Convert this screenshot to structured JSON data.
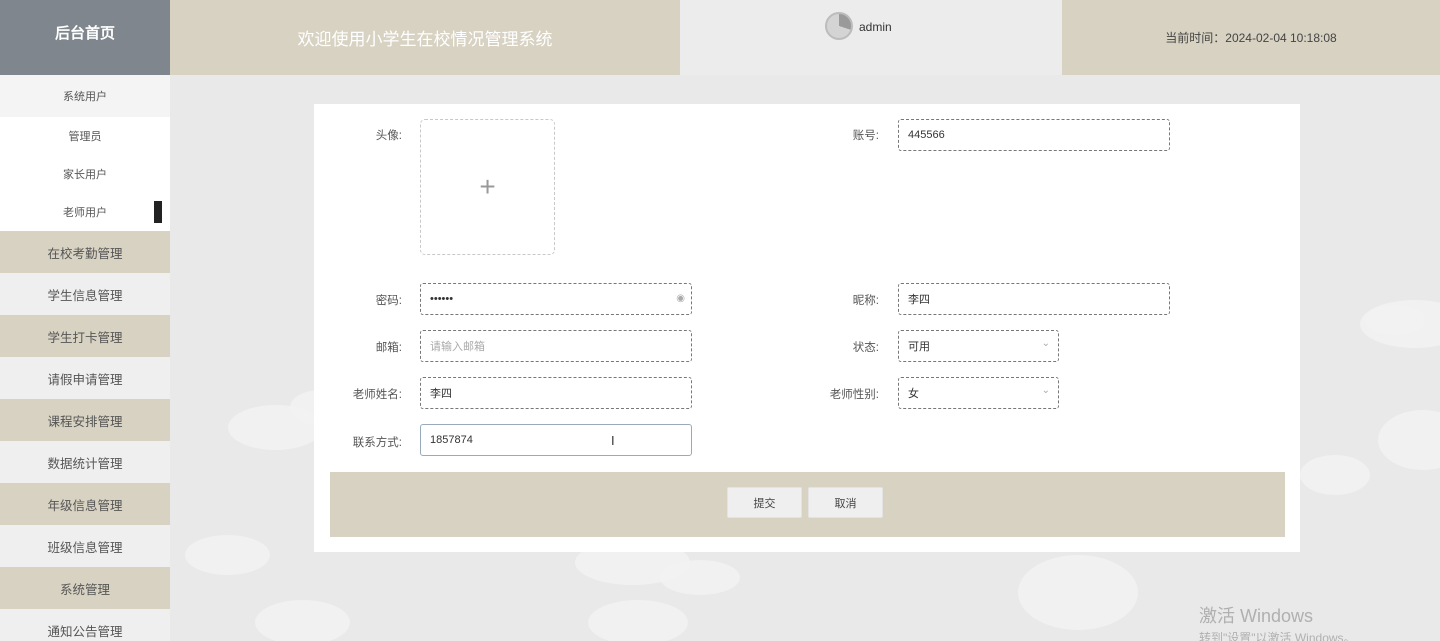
{
  "header": {
    "home_label": "后台首页",
    "title": "欢迎使用小学生在校情况管理系统",
    "username": "admin",
    "current_time": "当前时间：2024-02-04 10:18:08"
  },
  "sidebar": {
    "system_users": "系统用户",
    "sub_items": [
      "管理员",
      "家长用户",
      "老师用户"
    ],
    "menu": [
      "在校考勤管理",
      "学生信息管理",
      "学生打卡管理",
      "请假申请管理",
      "课程安排管理",
      "数据统计管理",
      "年级信息管理",
      "班级信息管理",
      "系统管理",
      "通知公告管理"
    ]
  },
  "form": {
    "avatar_label": "头像:",
    "account_label": "账号:",
    "account_value": "445566",
    "password_label": "密码:",
    "password_value": "••••••",
    "nickname_label": "昵称:",
    "nickname_value": "李四",
    "email_label": "邮箱:",
    "email_placeholder": "请输入邮箱",
    "status_label": "状态:",
    "status_value": "可用",
    "teacher_name_label": "老师姓名:",
    "teacher_name_value": "李四",
    "teacher_gender_label": "老师性别:",
    "teacher_gender_value": "女",
    "contact_label": "联系方式:",
    "contact_value": "1857874",
    "submit_label": "提交",
    "cancel_label": "取消"
  },
  "watermark": {
    "line1": "激活 Windows",
    "line2": "转到\"设置\"以激活 Windows。"
  }
}
